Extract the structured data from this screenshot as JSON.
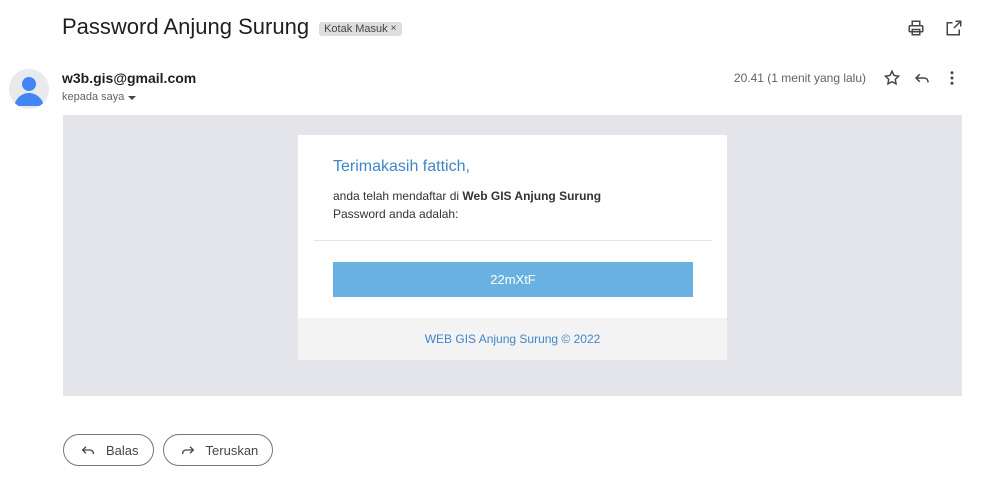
{
  "email": {
    "subject": "Password Anjung Surung",
    "label_chip": "Kotak Masuk",
    "label_close": "×",
    "sender": "w3b.gis@gmail.com",
    "recipient": "kepada saya",
    "timestamp": "20.41 (1 menit yang lalu)"
  },
  "icons": {
    "print": "print-icon",
    "open_new": "open-in-new-window-icon",
    "star": "star-icon",
    "reply": "reply-icon",
    "more": "more-vert-icon",
    "forward": "forward-icon",
    "avatar": "avatar-icon"
  },
  "body": {
    "greeting": "Terimakasih fattich,",
    "line1_prefix": "anda telah mendaftar di ",
    "line1_bold": "Web GIS Anjung Surung",
    "line2": "Password anda adalah:",
    "password": "22mXtF",
    "footer": "WEB GIS Anjung Surung © 2022"
  },
  "actions": {
    "reply_label": "Balas",
    "forward_label": "Teruskan"
  },
  "colors": {
    "accent_blue": "#3f86c8",
    "password_box": "#69b1e0",
    "email_bg": "#e3e5ea",
    "avatar_blue": "#4285f4"
  }
}
